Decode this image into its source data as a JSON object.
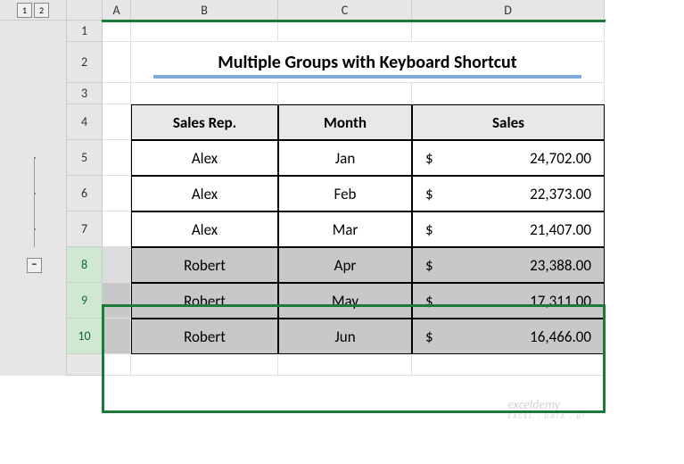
{
  "outline": {
    "levels": [
      "1",
      "2"
    ],
    "collapse": "−"
  },
  "columns": [
    "A",
    "B",
    "C",
    "D"
  ],
  "rows": [
    "1",
    "2",
    "3",
    "4",
    "5",
    "6",
    "7",
    "8",
    "9",
    "10"
  ],
  "title": "Multiple Groups with Keyboard Shortcut",
  "headers": {
    "rep": "Sales Rep.",
    "month": "Month",
    "sales": "Sales"
  },
  "currency": "$",
  "data": [
    {
      "rep": "Alex",
      "month": "Jan",
      "sales": "24,702.00"
    },
    {
      "rep": "Alex",
      "month": "Feb",
      "sales": "22,373.00"
    },
    {
      "rep": "Alex",
      "month": "Mar",
      "sales": "21,407.00"
    },
    {
      "rep": "Robert",
      "month": "Apr",
      "sales": "23,388.00"
    },
    {
      "rep": "Robert",
      "month": "May",
      "sales": "17,311.00"
    },
    {
      "rep": "Robert",
      "month": "Jun",
      "sales": "16,466.00"
    }
  ],
  "watermark": {
    "main": "exceldemy",
    "sub": "EXCEL · DATA · BI"
  },
  "chart_data": {
    "type": "table",
    "title": "Multiple Groups with Keyboard Shortcut",
    "columns": [
      "Sales Rep.",
      "Month",
      "Sales"
    ],
    "rows": [
      [
        "Alex",
        "Jan",
        24702.0
      ],
      [
        "Alex",
        "Feb",
        22373.0
      ],
      [
        "Alex",
        "Mar",
        21407.0
      ],
      [
        "Robert",
        "Apr",
        23388.0
      ],
      [
        "Robert",
        "May",
        17311.0
      ],
      [
        "Robert",
        "Jun",
        16466.0
      ]
    ]
  }
}
